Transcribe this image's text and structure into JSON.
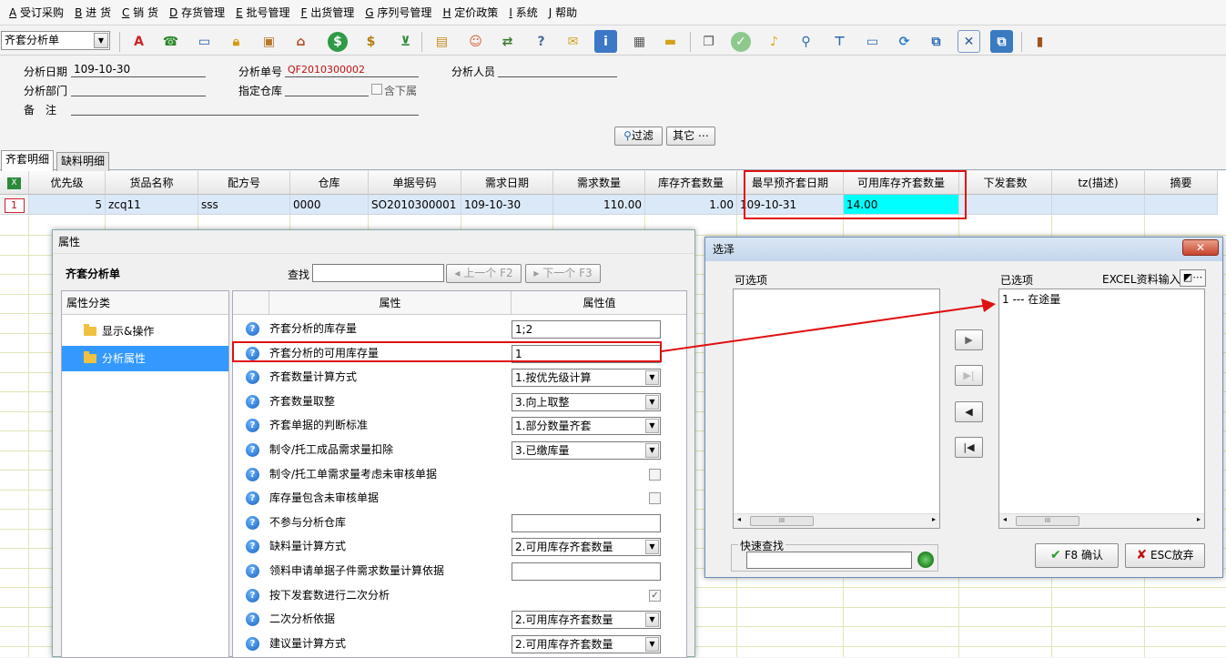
{
  "menu": [
    {
      "key": "A",
      "label": "受订采购"
    },
    {
      "key": "B",
      "label": "进 货"
    },
    {
      "key": "C",
      "label": "销 货"
    },
    {
      "key": "D",
      "label": "存货管理"
    },
    {
      "key": "E",
      "label": "批号管理"
    },
    {
      "key": "F",
      "label": "出货管理"
    },
    {
      "key": "G",
      "label": "序列号管理"
    },
    {
      "key": "H",
      "label": "定价政策"
    },
    {
      "key": "I",
      "label": "系统"
    },
    {
      "key": "J",
      "label": "帮助"
    }
  ],
  "toolbar": {
    "form_select": "齐套分析单"
  },
  "header": {
    "date_label": "分析日期",
    "date_value": "109-10-30",
    "no_label": "分析单号",
    "no_value": "QF2010300002",
    "person_label": "分析人员",
    "person_value": "",
    "dept_label": "分析部门",
    "dept_value": "",
    "wh_label": "指定仓库",
    "wh_value": "",
    "sub_label": "含下属",
    "note_label": "备　注",
    "note_value": "",
    "filter_btn": "过滤",
    "other_btn": "其它 ⋯"
  },
  "tabs": [
    "齐套明细",
    "缺料明细"
  ],
  "grid": {
    "columns": [
      "优先级",
      "货品名称",
      "配方号",
      "仓库",
      "单据号码",
      "需求日期",
      "需求数量",
      "库存齐套数量",
      "最早预齐套日期",
      "可用库存齐套数量",
      "下发套数",
      "tz(描述)",
      "摘要"
    ],
    "rows": [
      {
        "num": "1",
        "cells": [
          "5",
          "zcq11",
          "sss",
          "0000",
          "SO2010300001",
          "109-10-30",
          "110.00",
          "1.00",
          "109-10-31",
          "14.00",
          "",
          "",
          ""
        ]
      }
    ]
  },
  "prop_dialog": {
    "title": "属性",
    "subject": "齐套分析单",
    "search_label": "查找",
    "search_value": "",
    "prev_btn": "上一个 F2",
    "next_btn": "下一个 F3",
    "cat_header": "属性分类",
    "categories": [
      "显示&操作",
      "分析属性"
    ],
    "col_prop": "属性",
    "col_value": "属性值",
    "rows": [
      {
        "name": "齐套分析的库存量",
        "value": "1;2",
        "type": "text"
      },
      {
        "name": "齐套分析的可用库存量",
        "value": "1",
        "type": "text"
      },
      {
        "name": "齐套数量计算方式",
        "value": "1.按优先级计算",
        "type": "select"
      },
      {
        "name": "齐套数量取整",
        "value": "3.向上取整",
        "type": "select"
      },
      {
        "name": "齐套单据的判断标准",
        "value": "1.部分数量齐套",
        "type": "select"
      },
      {
        "name": "制令/托工成品需求量扣除",
        "value": "3.已缴库量",
        "type": "select"
      },
      {
        "name": "制令/托工单需求量考虑未审核单据",
        "value": "",
        "type": "check"
      },
      {
        "name": "库存量包含未审核单据",
        "value": "",
        "type": "check"
      },
      {
        "name": "不参与分析仓库",
        "value": "",
        "type": "text"
      },
      {
        "name": "缺料量计算方式",
        "value": "2.可用库存齐套数量",
        "type": "select"
      },
      {
        "name": "领料申请单据子件需求数量计算依据",
        "value": "",
        "type": "text"
      },
      {
        "name": "按下发套数进行二次分析",
        "value": "✓",
        "type": "check"
      },
      {
        "name": "二次分析依据",
        "value": "2.可用库存齐套数量",
        "type": "select"
      },
      {
        "name": "建议量计算方式",
        "value": "2.可用库存齐套数量",
        "type": "select"
      }
    ]
  },
  "select_dialog": {
    "title": "选泽",
    "available_label": "可选项",
    "selected_label": "已选项",
    "excel_label": "EXCEL资料输入",
    "selected_items": [
      "1 --- 在途量"
    ],
    "quick_search_label": "快速查找",
    "quick_search_value": "",
    "ok_btn": "F8 确认",
    "cancel_btn": "ESC放弃"
  }
}
